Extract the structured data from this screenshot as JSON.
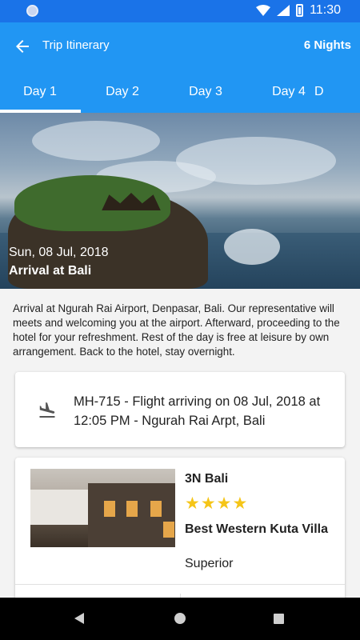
{
  "status_bar": {
    "time": "11:30"
  },
  "app_bar": {
    "title": "Trip Itinerary",
    "nights": "6 Nights"
  },
  "tabs": [
    {
      "label": "Day 1",
      "selected": true
    },
    {
      "label": "Day 2",
      "selected": false
    },
    {
      "label": "Day 3",
      "selected": false
    },
    {
      "label": "Day 4",
      "selected": false
    },
    {
      "label": "D",
      "selected": false
    }
  ],
  "hero": {
    "date": "Sun, 08 Jul, 2018",
    "heading": "Arrival at Bali"
  },
  "description": "Arrival at Ngurah Rai Airport, Denpasar, Bali. Our representative will meets and welcoming you at the airport. Afterward, proceeding to the hotel for your refreshment. Rest of the day is free at leisure by own arrangement. Back to the hotel, stay overnight.",
  "flight": {
    "icon": "flight-land-icon",
    "text": "MH-715 - Flight arriving on 08 Jul, 2018 at 12:05 PM - Ngurah Rai Arpt, Bali"
  },
  "hotel": {
    "location": "3N Bali",
    "stars": 4,
    "star_glyph": "★",
    "name": "Best Western Kuta Villa",
    "category": "Superior"
  },
  "colors": {
    "primary": "#2196f3",
    "status_bar": "#1a73e8",
    "star": "#f5c518"
  }
}
